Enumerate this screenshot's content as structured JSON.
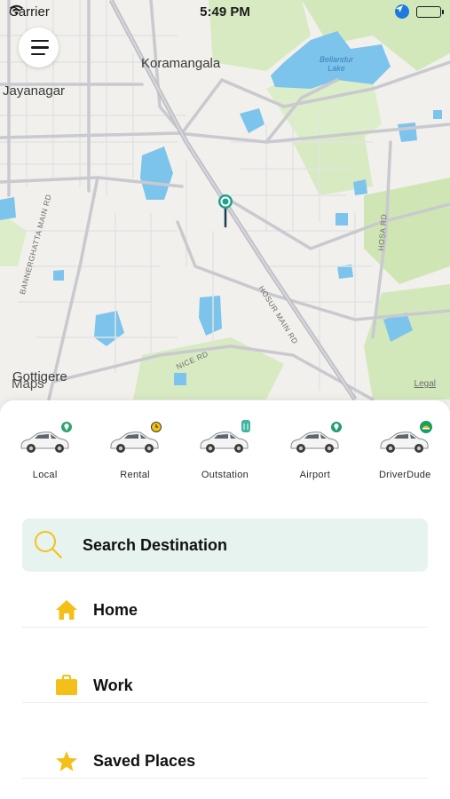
{
  "status_bar": {
    "carrier": "Carrier",
    "time": "5:49 PM"
  },
  "map": {
    "area_labels": [
      "Koramangala",
      "Jayanagar",
      "Gottigere"
    ],
    "water_label": "Bellandur\nLake",
    "road_labels": [
      "BANNERGHATTA MAIN RD",
      "HOSUR MAIN RD",
      "HOSA RD",
      "NICE RD"
    ],
    "maps_logo": "Maps",
    "legal_link": "Legal",
    "colors": {
      "land": "#f1f0ec",
      "park": "#cfe6b4",
      "water": "#7cc4ec",
      "road": "#c9c9cf",
      "pin": "#20a28c"
    }
  },
  "services": [
    {
      "label": "Local",
      "badge_color": "#2ea36b",
      "badge_icon": "map-pin-icon"
    },
    {
      "label": "Rental",
      "badge_color": "#f4c20d",
      "badge_icon": "clock-icon"
    },
    {
      "label": "Outstation",
      "badge_color": "#3fb6a1",
      "badge_icon": "luggage-icon"
    },
    {
      "label": "Airport",
      "badge_color": "#1f9c77",
      "badge_icon": "map-pin-icon"
    },
    {
      "label": "DriverDude",
      "badge_color": "#1b9e66",
      "badge_icon": "driver-cap-icon"
    }
  ],
  "search": {
    "label": "Search Destination",
    "background": "#e7f3ef",
    "icon_color": "#f0c419"
  },
  "saved_places": [
    {
      "label": "Home",
      "icon": "home-icon"
    },
    {
      "label": "Work",
      "icon": "briefcase-icon"
    },
    {
      "label": "Saved Places",
      "icon": "star-icon"
    }
  ],
  "accent_color": "#f4bf18"
}
